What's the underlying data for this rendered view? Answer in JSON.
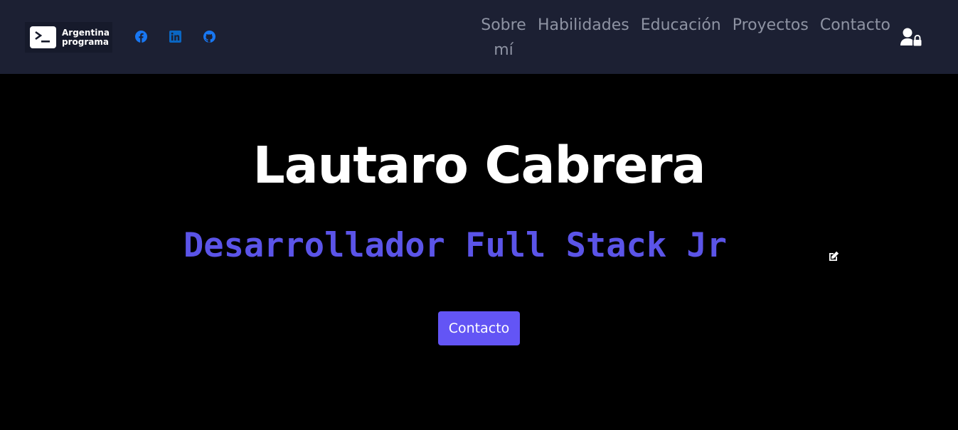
{
  "brand": {
    "icon": "terminal-prompt-icon",
    "line1": "Argentina",
    "line2": "programa"
  },
  "social": [
    {
      "name": "facebook",
      "icon": "facebook-icon",
      "color": "#1877f2"
    },
    {
      "name": "linkedin",
      "icon": "linkedin-icon",
      "color": "#0a66c2"
    },
    {
      "name": "github",
      "icon": "github-icon",
      "color": "#1877f2"
    }
  ],
  "nav": {
    "items": [
      {
        "label": "Sobre mí"
      },
      {
        "label": "Habilidades"
      },
      {
        "label": "Educación"
      },
      {
        "label": "Proyectos"
      },
      {
        "label": "Contacto"
      }
    ],
    "login_icon": "user-lock-icon"
  },
  "hero": {
    "title": "Lautaro Cabrera",
    "subtitle": "Desarrollador Full Stack Jr",
    "edit_icon": "edit-icon",
    "button_label": "Contacto"
  },
  "colors": {
    "navbar_bg": "#1c2033",
    "hero_bg": "#000000",
    "accent": "#6355f5",
    "subtitle": "#5b54e8",
    "nav_text": "#8e93a3"
  }
}
